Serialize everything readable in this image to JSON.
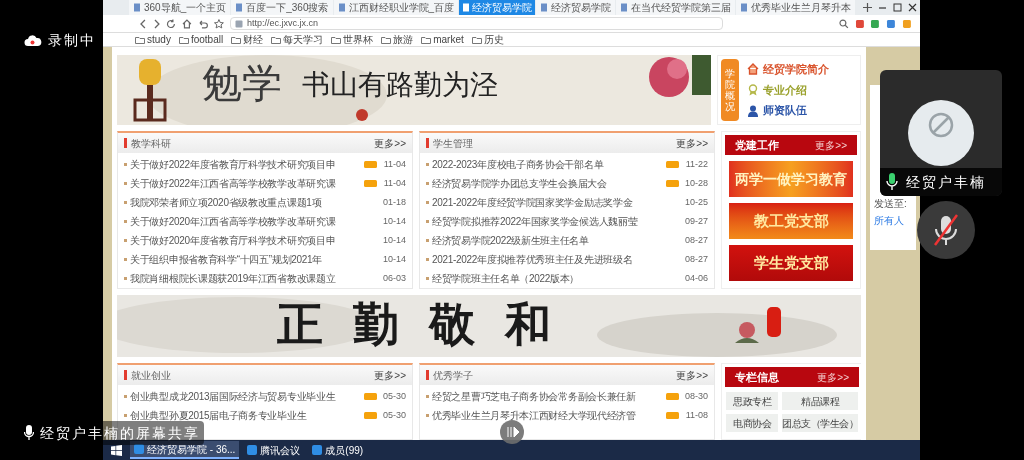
{
  "recording": {
    "label": "录制中"
  },
  "screen_share": {
    "label": "经贸户丰楠的屏幕共享"
  },
  "browser": {
    "tabs": [
      {
        "label": "360导航_一个主页",
        "selected": false
      },
      {
        "label": "百度一下_360搜索",
        "selected": false
      },
      {
        "label": "江西财经职业学院_百度",
        "selected": false
      },
      {
        "label": "经济贸易学院",
        "selected": true
      },
      {
        "label": "经济贸易学院",
        "selected": false
      },
      {
        "label": "在当代经贸学院第三届",
        "selected": false
      },
      {
        "label": "优秀毕业生兰月琴升本",
        "selected": false
      }
    ],
    "url": "http://ec.jxvc.jx.cn",
    "bookmarks": [
      "study",
      "football",
      "财经",
      "每天学习",
      "世界杯",
      "旅游",
      "market",
      "历史"
    ]
  },
  "page": {
    "banner": {
      "calligraphy": "勉学",
      "motto": "书山有路勤为泾"
    },
    "about": {
      "title": "学院概况",
      "links": [
        {
          "label": "经贸学院简介",
          "kind": "house"
        },
        {
          "label": "专业介绍",
          "kind": "award"
        },
        {
          "label": "师资队伍",
          "kind": "person"
        }
      ]
    },
    "news_panels": [
      {
        "title": "教学科研",
        "more": "更多>>",
        "items": [
          {
            "text": "关于做好2022年度省教育厅科学技术研究项目申",
            "new": true,
            "date": "11-04"
          },
          {
            "text": "关于做好2022年江西省高等学校教学改革研究课",
            "new": true,
            "date": "11-04"
          },
          {
            "text": "我院邓荣者师立项2020省级教改重点课题1项",
            "new": false,
            "date": "01-18"
          },
          {
            "text": "关于做好2020年江西省高等学校教学改革研究课",
            "new": false,
            "date": "10-14"
          },
          {
            "text": "关于做好2020年度省教育厅科学技术研究项目申",
            "new": false,
            "date": "10-14"
          },
          {
            "text": "关于组织申报省教育科学“十四五”规划2021年",
            "new": false,
            "date": "10-14"
          },
          {
            "text": "我院肖细根院长课题获2019年江西省教改课题立",
            "new": false,
            "date": "06-03"
          }
        ]
      },
      {
        "title": "学生管理",
        "more": "更多>>",
        "items": [
          {
            "text": "2022-2023年度校电子商务协会干部名单",
            "new": true,
            "date": "11-22"
          },
          {
            "text": "经济贸易学院学办团总支学生会换届大会",
            "new": true,
            "date": "10-28"
          },
          {
            "text": "2021-2022年度经贸学院国家奖学金励志奖学金",
            "new": false,
            "date": "10-25"
          },
          {
            "text": "经贸学院拟推荐2022年国家奖学金候选人魏丽莹",
            "new": false,
            "date": "09-27"
          },
          {
            "text": "经济贸易学院2022级新生班主任名单",
            "new": false,
            "date": "08-27"
          },
          {
            "text": "2021-2022年度拟推荐优秀班主任及先进班级名",
            "new": false,
            "date": "08-27"
          },
          {
            "text": "经贸学院班主任名单（2022版本）",
            "new": false,
            "date": "04-06"
          }
        ]
      }
    ],
    "party": {
      "title": "党建工作",
      "more": "更多>>",
      "banners": [
        "两学一做学习教育",
        "教工党支部",
        "学生党支部"
      ]
    },
    "banner2": {
      "text": "正勤敬和"
    },
    "bottom_panels": [
      {
        "title": "就业创业",
        "more": "更多>>",
        "items": [
          {
            "text": "创业典型成龙2013届国际经济与贸易专业毕业生",
            "new": true,
            "date": "05-30"
          },
          {
            "text": "创业典型孙夏2015届电子商务专业毕业生",
            "new": true,
            "date": "05-30"
          }
        ]
      },
      {
        "title": "优秀学子",
        "more": "更多>>",
        "items": [
          {
            "text": "经贸之星曹巧芝电子商务协会常务副会长兼任新",
            "new": true,
            "date": "08-30"
          },
          {
            "text": "优秀毕业生兰月琴升本江西财经大学现代经济管",
            "new": true,
            "date": "11-08"
          }
        ]
      }
    ],
    "columns": {
      "title": "专栏信息",
      "more": "更多>>",
      "buttons": [
        "思政专栏",
        "精品课程",
        "电商协会",
        "团总支（学生会）"
      ]
    }
  },
  "participant": {
    "name": "经贸户丰楠",
    "muted": false
  },
  "self_mic": {
    "muted": true
  },
  "chat_panel": {
    "label": "发送至:",
    "target": "所有人"
  },
  "taskbar": {
    "items": [
      {
        "label": "经济贸易学院 - 36...",
        "selected": true
      },
      {
        "label": "腾讯会议",
        "selected": false
      },
      {
        "label": "成员(99)",
        "selected": false
      }
    ]
  }
}
